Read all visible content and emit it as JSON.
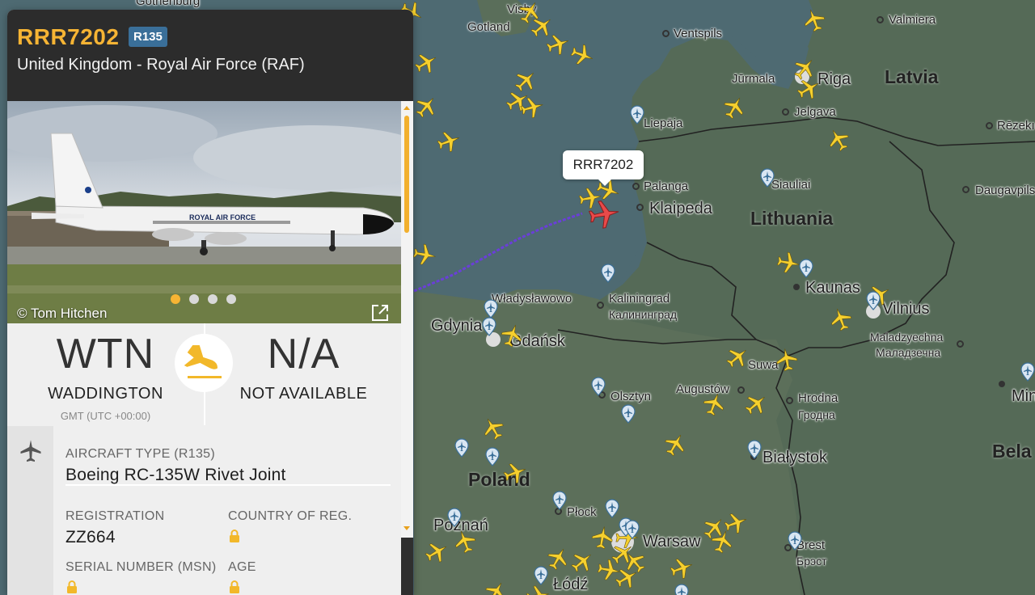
{
  "map": {
    "countries": {
      "latvia": "Latvia",
      "lithuania": "Lithuania",
      "poland": "Poland",
      "belarus": "Bela"
    },
    "cities": {
      "gothenburg": "Gothenburg",
      "visby": "Visby",
      "gotland": "Gotland",
      "ventspils": "Ventspils",
      "valmiera": "Valmiera",
      "jurmala": "Jūrmala",
      "riga": "Riga",
      "jelgava": "Jelgava",
      "liepaja": "Liepāja",
      "rezekne": "Rēzekı",
      "palanga": "Palanga",
      "klaipeda": "Klaipeda",
      "siauliai": "Siauliai",
      "daugavpils": "Daugavpils",
      "kaunas": "Kaunas",
      "vilnius": "Vilnius",
      "molodechno": "Maladzyechna",
      "molodechno_cyr": "Маладзечна",
      "minsk": "Min",
      "wladyslawowo": "Władysławowo",
      "gdynia": "Gdynia",
      "gdansk": "Gdańsk",
      "kaliningrad": "Kaliningrad",
      "kaliningrad_cyr": "Калининград",
      "suwalki": "Suwa",
      "olsztyn": "Olsztyn",
      "augustow": "Augustów",
      "hrodna": "Hrodna",
      "hrodna_cyr": "Гродна",
      "bialystok": "Białystok",
      "plock": "Płock",
      "poznan": "Poznań",
      "warsaw": "Warsaw",
      "lodz": "Łódź",
      "brest": "Brest",
      "brest_cyr": "Брэст"
    },
    "callout": "RRR7202"
  },
  "flight": {
    "callsign": "RRR7202",
    "type_badge": "R135",
    "operator": "United Kingdom - Royal Air Force (RAF)",
    "photo_credit": "© Tom Hitchen",
    "photo_count": 4,
    "photo_index": 1,
    "photo_livery_text": "ROYAL AIR FORCE",
    "origin": {
      "code": "WTN",
      "name": "WADDINGTON",
      "tz": "GMT (UTC +00:00)"
    },
    "destination": {
      "code": "N/A",
      "name": "NOT AVAILABLE"
    },
    "aircraft": {
      "type_label": "AIRCRAFT TYPE (R135)",
      "type_value": "Boeing RC-135W Rivet Joint",
      "registration_label": "REGISTRATION",
      "registration_value": "ZZ664",
      "country_label": "COUNTRY OF REG.",
      "serial_label": "SERIAL NUMBER (MSN)",
      "age_label": "AGE"
    }
  },
  "colors": {
    "accent": "#f6b434",
    "badge": "#3a6f99",
    "track": "#6a3fd8",
    "selected_plane": "#e84a4a",
    "plane": "#f6d02e"
  },
  "icons": {
    "plane": "plane-icon",
    "landing": "airplane-landing-icon",
    "pin": "airport-pin-icon",
    "lock": "lock-icon",
    "external": "external-link-icon"
  }
}
